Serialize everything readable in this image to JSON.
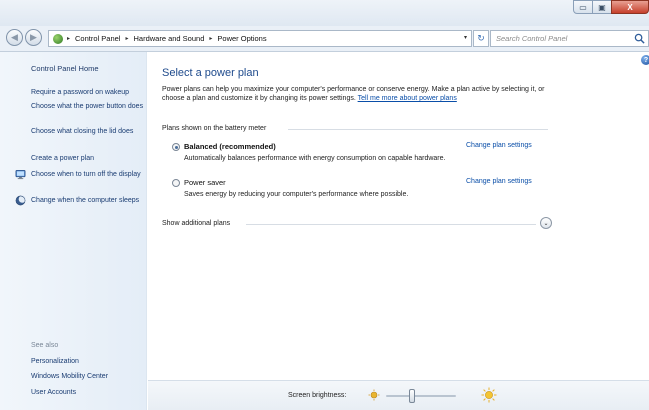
{
  "window": {
    "min_glyph": "▭",
    "max_glyph": "▣",
    "close_glyph": "X"
  },
  "nav": {
    "back_glyph": "◀",
    "forward_glyph": "▶",
    "breadcrumbs": [
      "Control Panel",
      "Hardware and Sound",
      "Power Options"
    ],
    "crumb_sep": "▸",
    "dropdown_glyph": "▾",
    "refresh_glyph": "↻",
    "search_placeholder": "Search Control Panel"
  },
  "sidebar": {
    "home": "Control Panel Home",
    "links": [
      {
        "label": "Require a password on wakeup"
      },
      {
        "label": "Choose what the power button does"
      },
      {
        "label": "Choose what closing the lid does"
      },
      {
        "label": "Create a power plan"
      },
      {
        "label": "Choose when to turn off the display",
        "icon": "monitor-icon"
      },
      {
        "label": "Change when the computer sleeps",
        "icon": "moon-icon"
      }
    ],
    "see_also_label": "See also",
    "see_also": [
      "Personalization",
      "Windows Mobility Center",
      "User Accounts"
    ]
  },
  "main": {
    "title": "Select a power plan",
    "intro_text": "Power plans can help you maximize your computer's performance or conserve energy. Make a plan active by selecting it, or choose a plan and customize it by changing its power settings. ",
    "intro_link": "Tell me more about power plans",
    "section_label": "Plans shown on the battery meter",
    "plans": [
      {
        "name": "Balanced (recommended)",
        "description": "Automatically balances performance with energy consumption on capable hardware.",
        "change_link": "Change plan settings",
        "selected": true
      },
      {
        "name": "Power saver",
        "description": "Saves energy by reducing your computer's performance where possible.",
        "change_link": "Change plan settings",
        "selected": false
      }
    ],
    "show_additional": "Show additional plans",
    "expand_glyph": "⌄",
    "help_glyph": "?"
  },
  "status": {
    "brightness_label": "Screen brightness:",
    "brightness_level": 0.36
  },
  "colors": {
    "link": "#0a4ea8",
    "title": "#1e4a8c",
    "sidebar_bg": "#eaf1f8",
    "close_button": "#c6402c"
  }
}
